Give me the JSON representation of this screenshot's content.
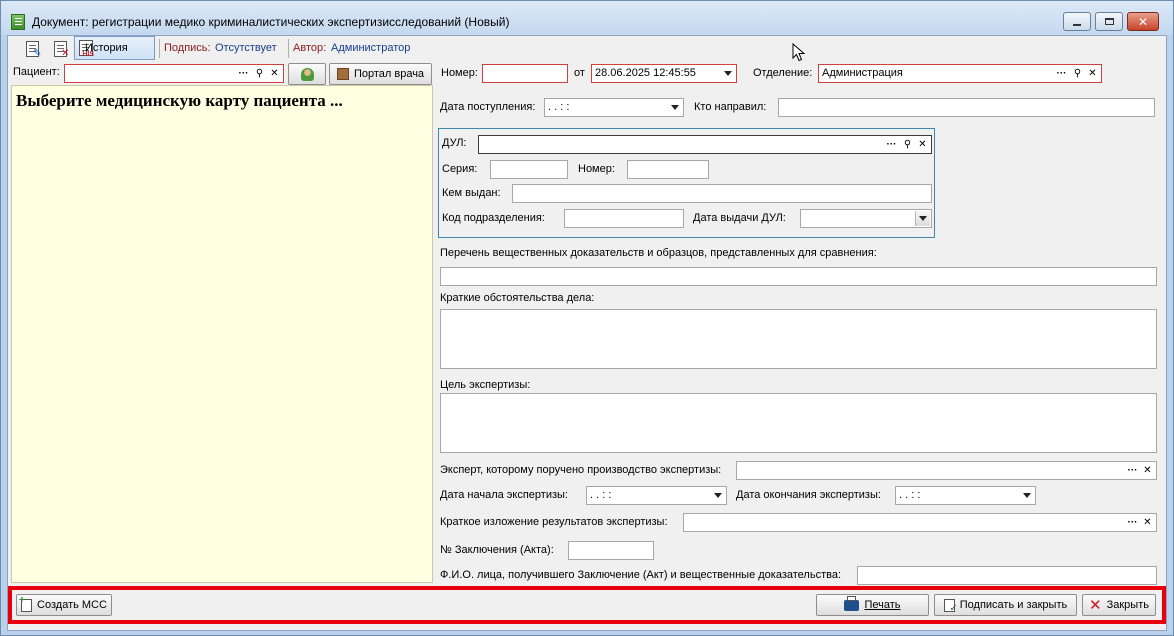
{
  "window": {
    "title": "Документ: регистрации медико криминалистических экспертизисследований (Новый)"
  },
  "toolbar": {
    "history_label": "История",
    "signature_label": "Подпись:",
    "signature_value": "Отсутствует",
    "author_label": "Автор:",
    "author_value": "Администратор"
  },
  "patient": {
    "label": "Пациент:",
    "value": "",
    "portal_button": "Портал врача",
    "hint": "Выберите медицинскую карту пациента ..."
  },
  "header": {
    "number_label": "Номер:",
    "number_value": "",
    "from_label": "от",
    "date_value": "28.06.2025 12:45:55",
    "department_label": "Отделение:",
    "department_value": "Администрация"
  },
  "form": {
    "admission_date_label": "Дата поступления:",
    "admission_date_value": " .  .       :  :",
    "referred_by_label": "Кто направил:",
    "dul_label": "ДУЛ:",
    "series_label": "Серия:",
    "number_label": "Номер:",
    "issued_by_label": "Кем выдан:",
    "division_code_label": "Код подразделения:",
    "dul_issue_date_label": "Дата выдачи ДУЛ:",
    "evidence_list_label": "Перечень вещественных доказательств и образцов, представленных для сравнения:",
    "circumstances_label": "Краткие обстоятельства дела:",
    "purpose_label": "Цель экспертизы:",
    "expert_label": "Эксперт, которому поручено производство экспертизы:",
    "start_date_label": "Дата начала экспертизы:",
    "start_date_value": " .  .       :  :",
    "end_date_label": "Дата окончания экспертизы:",
    "end_date_value": " .  .       :  :",
    "results_label": "Краткое изложение результатов экспертизы:",
    "conclusion_no_label": "№ Заключения (Акта):",
    "recipient_label": "Ф.И.О. лица, получившего Заключение (Акт) и вещественные доказательства:"
  },
  "footer": {
    "create_mss": "Создать МСС",
    "print": "Печать",
    "sign_and_close": "Подписать и закрыть",
    "close": "Закрыть"
  },
  "colors": {
    "required_border": "#d14040",
    "highlight_frame": "#e8000c",
    "group_border": "#3f87a8",
    "patient_panel_bg": "#ffffe1"
  }
}
